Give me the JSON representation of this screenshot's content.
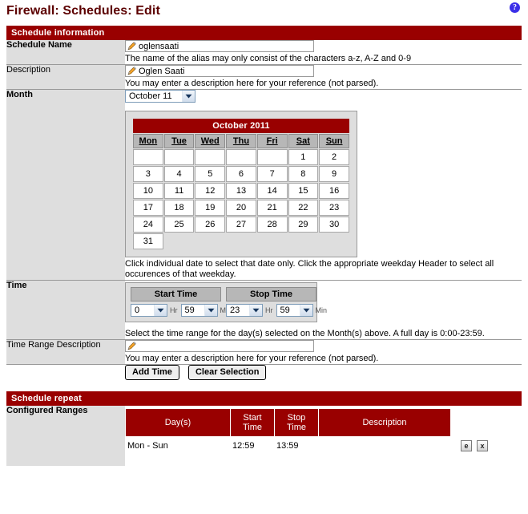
{
  "header": {
    "title": "Firewall: Schedules: Edit",
    "help_icon": "help-icon",
    "help_glyph": "?"
  },
  "schedule_information": {
    "panel_title": "Schedule information",
    "rows": {
      "schedule_name": {
        "label": "Schedule Name",
        "value": "oglensaati",
        "hint": "The name of the alias may only consist of the characters a-z, A-Z and 0-9"
      },
      "description": {
        "label": "Description",
        "value": "Oglen Saati",
        "hint": "You may enter a description here for your reference (not parsed)."
      },
      "month": {
        "label": "Month",
        "selected": "October 11",
        "hint": "Click individual date to select that date only. Click the appropriate weekday Header to select all occurences of that weekday."
      },
      "time": {
        "label": "Time",
        "hint": "Select the time range for the day(s) selected on the Month(s) above. A full day is 0:00-23:59."
      },
      "time_range_description": {
        "label": "Time Range Description",
        "value": "",
        "hint": "You may enter a description here for your reference (not parsed)."
      }
    },
    "calendar": {
      "title": "October 2011",
      "weekdays": [
        "Mon",
        "Tue",
        "Wed",
        "Thu",
        "Fri",
        "Sat",
        "Sun"
      ],
      "weeks": [
        [
          "",
          "",
          "",
          "",
          "",
          "1",
          "2"
        ],
        [
          "3",
          "4",
          "5",
          "6",
          "7",
          "8",
          "9"
        ],
        [
          "10",
          "11",
          "12",
          "13",
          "14",
          "15",
          "16"
        ],
        [
          "17",
          "18",
          "19",
          "20",
          "21",
          "22",
          "23"
        ],
        [
          "24",
          "25",
          "26",
          "27",
          "28",
          "29",
          "30"
        ],
        [
          "31",
          "",
          "",
          "",
          "",
          "",
          ""
        ]
      ]
    },
    "time_controls": {
      "start_label": "Start Time",
      "stop_label": "Stop Time",
      "start_hour": "0",
      "start_min": "59",
      "stop_hour": "23",
      "stop_min": "59",
      "hour_unit": "Hr",
      "min_unit": "Min"
    },
    "buttons": {
      "add_time": "Add Time",
      "clear_selection": "Clear Selection"
    }
  },
  "schedule_repeat": {
    "panel_title": "Schedule repeat",
    "configured_ranges_label": "Configured Ranges",
    "columns": {
      "days": "Day(s)",
      "start_time": "Start\nTime",
      "start_time_l1": "Start",
      "start_time_l2": "Time",
      "stop_time_l1": "Stop",
      "stop_time_l2": "Time",
      "description": "Description"
    },
    "rows": [
      {
        "days": "Mon - Sun",
        "start_time": "12:59",
        "stop_time": "13:59",
        "description": "",
        "edit_icon": "edit-icon",
        "delete_icon": "delete-icon",
        "edit_glyph": "e",
        "delete_glyph": "x"
      }
    ]
  },
  "colors": {
    "accent_red": "#990000",
    "title_red": "#5c0000",
    "label_bg": "#dedede",
    "help_blue": "#3b2fe8"
  }
}
